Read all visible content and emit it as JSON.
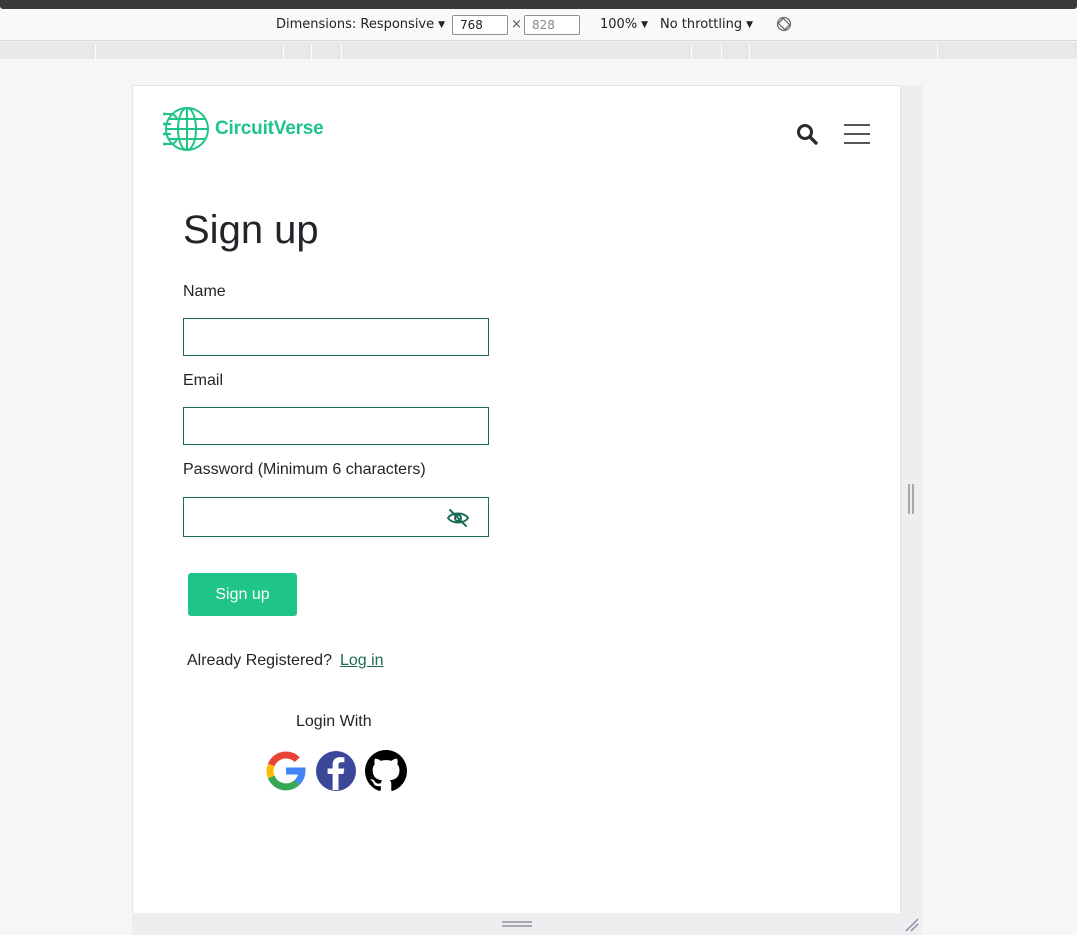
{
  "devtools": {
    "dimensions_label": "Dimensions: Responsive",
    "width_value": "768",
    "times": "×",
    "height_placeholder": "828",
    "zoom": "100%",
    "throttling": "No throttling"
  },
  "header": {
    "brand": "CircuitVerse"
  },
  "form": {
    "title": "Sign up",
    "name_label": "Name",
    "email_label": "Email",
    "password_label": "Password (Minimum 6 characters)",
    "submit_label": "Sign up"
  },
  "login": {
    "prompt": "Already Registered?",
    "link": "Log in"
  },
  "social": {
    "heading": "Login With",
    "providers": [
      "google-icon",
      "facebook-icon",
      "github-icon"
    ]
  },
  "colors": {
    "brand": "#1fc487",
    "field_border": "#1c6b55",
    "facebook": "#3b4799"
  }
}
